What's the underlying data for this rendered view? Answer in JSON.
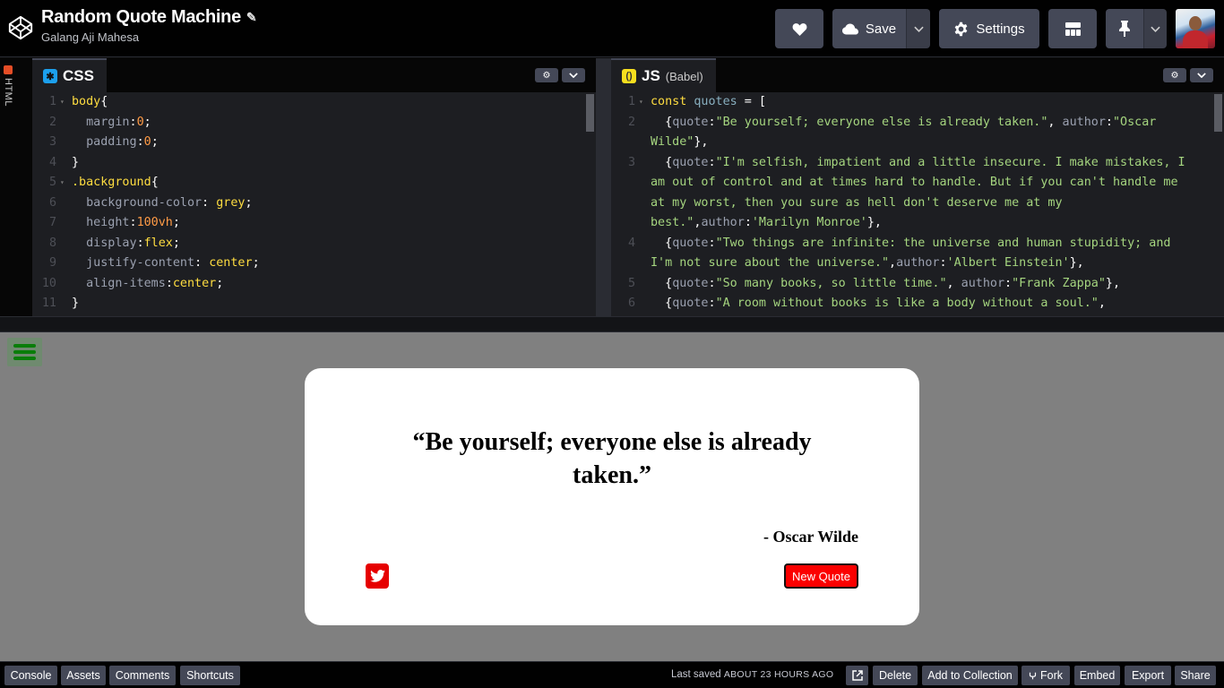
{
  "header": {
    "pen_title": "Random Quote Machine",
    "author": "Galang Aji Mahesa",
    "save_label": "Save",
    "settings_label": "Settings"
  },
  "editors": {
    "html_tab_label": "HTML",
    "css": {
      "tab_label": "CSS",
      "lines": [
        {
          "n": "1",
          "fold": true,
          "tokens": [
            {
              "t": "body",
              "c": "k-sel"
            },
            {
              "t": "{",
              "c": ""
            }
          ]
        },
        {
          "n": "2",
          "tokens": [
            {
              "t": "  margin",
              "c": "k-prop"
            },
            {
              "t": ":",
              "c": ""
            },
            {
              "t": "0",
              "c": "k-num"
            },
            {
              "t": ";",
              "c": ""
            }
          ]
        },
        {
          "n": "3",
          "tokens": [
            {
              "t": "  padding",
              "c": "k-prop"
            },
            {
              "t": ":",
              "c": ""
            },
            {
              "t": "0",
              "c": "k-num"
            },
            {
              "t": ";",
              "c": ""
            }
          ]
        },
        {
          "n": "4",
          "tokens": [
            {
              "t": "}",
              "c": ""
            }
          ]
        },
        {
          "n": "5",
          "fold": true,
          "tokens": [
            {
              "t": ".background",
              "c": "k-sel"
            },
            {
              "t": "{",
              "c": ""
            }
          ]
        },
        {
          "n": "6",
          "tokens": [
            {
              "t": "  background-color",
              "c": "k-prop"
            },
            {
              "t": ": ",
              "c": ""
            },
            {
              "t": "grey",
              "c": "k-val"
            },
            {
              "t": ";",
              "c": ""
            }
          ]
        },
        {
          "n": "7",
          "tokens": [
            {
              "t": "  height",
              "c": "k-prop"
            },
            {
              "t": ":",
              "c": ""
            },
            {
              "t": "100vh",
              "c": "k-num"
            },
            {
              "t": ";",
              "c": ""
            }
          ]
        },
        {
          "n": "8",
          "tokens": [
            {
              "t": "  display",
              "c": "k-prop"
            },
            {
              "t": ":",
              "c": ""
            },
            {
              "t": "flex",
              "c": "k-val"
            },
            {
              "t": ";",
              "c": ""
            }
          ]
        },
        {
          "n": "9",
          "tokens": [
            {
              "t": "  justify-content",
              "c": "k-prop"
            },
            {
              "t": ": ",
              "c": ""
            },
            {
              "t": "center",
              "c": "k-val"
            },
            {
              "t": ";",
              "c": ""
            }
          ]
        },
        {
          "n": "10",
          "tokens": [
            {
              "t": "  align-items",
              "c": "k-prop"
            },
            {
              "t": ":",
              "c": ""
            },
            {
              "t": "center",
              "c": "k-val"
            },
            {
              "t": ";",
              "c": ""
            }
          ]
        },
        {
          "n": "11",
          "tokens": [
            {
              "t": "}",
              "c": ""
            }
          ]
        }
      ]
    },
    "js": {
      "tab_label": "JS",
      "tab_sublabel": "(Babel)",
      "lines": [
        {
          "n": "1",
          "fold": true,
          "tokens": [
            {
              "t": "const ",
              "c": "k-kw"
            },
            {
              "t": "quotes",
              "c": "k-var"
            },
            {
              "t": " = [",
              "c": ""
            }
          ]
        },
        {
          "n": "2",
          "tokens": [
            {
              "t": "  {",
              "c": ""
            },
            {
              "t": "quote",
              "c": "k-key"
            },
            {
              "t": ":",
              "c": ""
            },
            {
              "t": "\"Be yourself; everyone else is already taken.\"",
              "c": "k-str"
            },
            {
              "t": ", ",
              "c": ""
            },
            {
              "t": "author",
              "c": "k-key"
            },
            {
              "t": ":",
              "c": ""
            },
            {
              "t": "\"Oscar Wilde\"",
              "c": "k-str"
            },
            {
              "t": "},",
              "c": ""
            }
          ]
        },
        {
          "n": "3",
          "tokens": [
            {
              "t": "  {",
              "c": ""
            },
            {
              "t": "quote",
              "c": "k-key"
            },
            {
              "t": ":",
              "c": ""
            },
            {
              "t": "\"I'm selfish, impatient and a little insecure. I make mistakes, I am out of control and at times hard to handle. But if you can't handle me at my worst, then you sure as hell don't deserve me at my best.\"",
              "c": "k-str"
            },
            {
              "t": ",",
              "c": ""
            },
            {
              "t": "author",
              "c": "k-key"
            },
            {
              "t": ":",
              "c": ""
            },
            {
              "t": "'Marilyn Monroe'",
              "c": "k-str"
            },
            {
              "t": "},",
              "c": ""
            }
          ]
        },
        {
          "n": "4",
          "tokens": [
            {
              "t": "  {",
              "c": ""
            },
            {
              "t": "quote",
              "c": "k-key"
            },
            {
              "t": ":",
              "c": ""
            },
            {
              "t": "\"Two things are infinite: the universe and human stupidity; and I'm not sure about the universe.\"",
              "c": "k-str"
            },
            {
              "t": ",",
              "c": ""
            },
            {
              "t": "author",
              "c": "k-key"
            },
            {
              "t": ":",
              "c": ""
            },
            {
              "t": "'Albert Einstein'",
              "c": "k-str"
            },
            {
              "t": "},",
              "c": ""
            }
          ]
        },
        {
          "n": "5",
          "tokens": [
            {
              "t": "  {",
              "c": ""
            },
            {
              "t": "quote",
              "c": "k-key"
            },
            {
              "t": ":",
              "c": ""
            },
            {
              "t": "\"So many books, so little time.\"",
              "c": "k-str"
            },
            {
              "t": ", ",
              "c": ""
            },
            {
              "t": "author",
              "c": "k-key"
            },
            {
              "t": ":",
              "c": ""
            },
            {
              "t": "\"Frank Zappa\"",
              "c": "k-str"
            },
            {
              "t": "},",
              "c": ""
            }
          ]
        },
        {
          "n": "6",
          "tokens": [
            {
              "t": "  {",
              "c": ""
            },
            {
              "t": "quote",
              "c": "k-key"
            },
            {
              "t": ":",
              "c": ""
            },
            {
              "t": "\"A room without books is like a body without a soul.\"",
              "c": "k-str"
            },
            {
              "t": ",",
              "c": ""
            }
          ]
        }
      ]
    }
  },
  "preview": {
    "quote": "“Be yourself; everyone else is already taken.”",
    "author": "- Oscar Wilde",
    "new_quote_label": "New Quote"
  },
  "footer": {
    "console": "Console",
    "assets": "Assets",
    "comments": "Comments",
    "shortcuts": "Shortcuts",
    "last_saved_prefix": "Last saved",
    "last_saved_ago": "about 23 hours ago",
    "delete": "Delete",
    "add_to_collection": "Add to Collection",
    "fork": "Fork",
    "embed": "Embed",
    "export": "Export",
    "share": "Share"
  },
  "icons": {
    "logo": "codepen-logo-icon",
    "heart": "heart-icon",
    "cloud": "cloud-icon",
    "gear": "gear-icon",
    "layout": "layout-grid-icon",
    "pin": "pin-icon",
    "chevron": "chevron-down-icon",
    "twitter": "twitter-icon",
    "external": "external-link-icon",
    "fork": "fork-icon",
    "menu": "hamburger-menu-icon"
  },
  "colors": {
    "preview_bg": "#808080",
    "new_quote_bg": "#fb0000",
    "twitter_bg": "#e60000",
    "hamburger": "#0a7d0a"
  }
}
